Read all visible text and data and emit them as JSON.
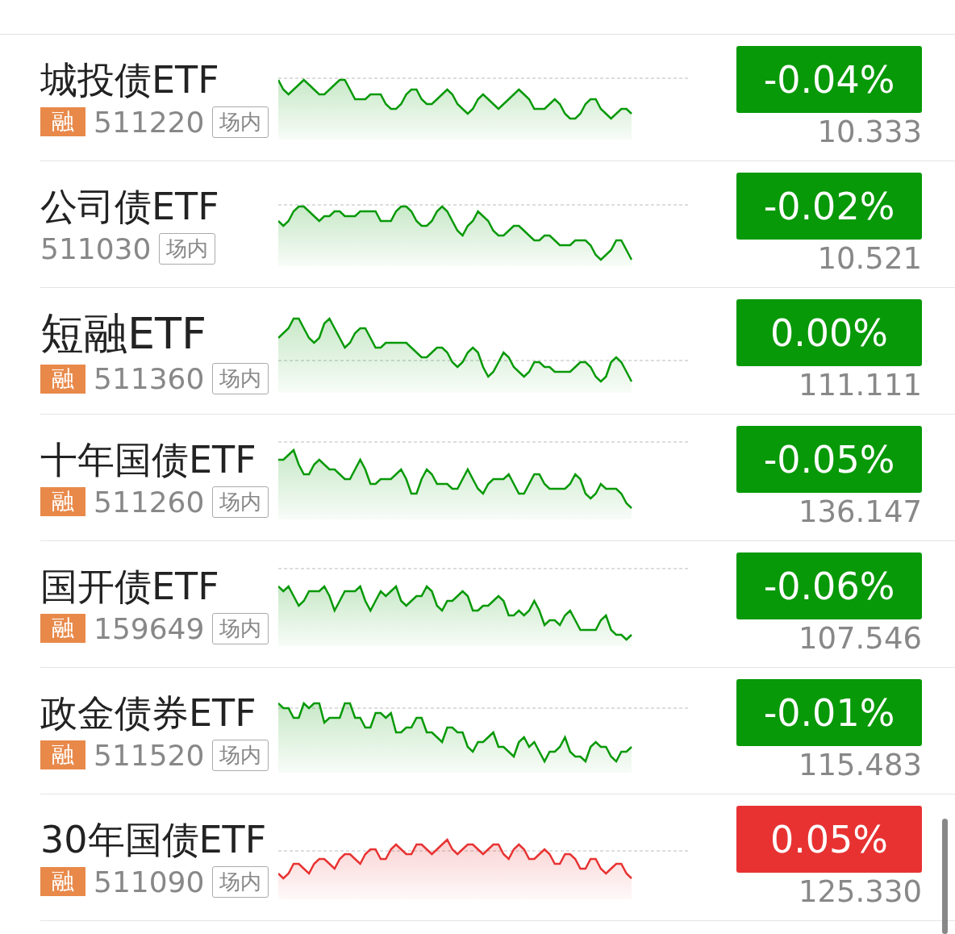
{
  "rows": [
    {
      "name": "城投债ETF",
      "margin_badge": "融",
      "code": "511220",
      "tag": "场内",
      "change": "-0.04%",
      "price": "10.333",
      "color": "#079907"
    },
    {
      "name": "公司债ETF",
      "code": "511030",
      "tag": "场内",
      "change": "-0.02%",
      "price": "10.521",
      "color": "#079907"
    },
    {
      "name": "短融ETF",
      "margin_badge": "融",
      "code": "511360",
      "tag": "场内",
      "change": "0.00%",
      "price": "111.111",
      "color": "#079907"
    },
    {
      "name": "十年国债ETF",
      "margin_badge": "融",
      "code": "511260",
      "tag": "场内",
      "change": "-0.05%",
      "price": "136.147",
      "color": "#079907"
    },
    {
      "name": "国开债ETF",
      "margin_badge": "融",
      "code": "159649",
      "tag": "场内",
      "change": "-0.06%",
      "price": "107.546",
      "color": "#079907"
    },
    {
      "name": "政金债券ETF",
      "margin_badge": "融",
      "code": "511520",
      "tag": "场内",
      "change": "-0.01%",
      "price": "115.483",
      "color": "#079907"
    },
    {
      "name": "30年国债ETF",
      "margin_badge": "融",
      "code": "511090",
      "tag": "场内",
      "change": "0.05%",
      "price": "125.330",
      "color": "#e83232"
    }
  ]
}
